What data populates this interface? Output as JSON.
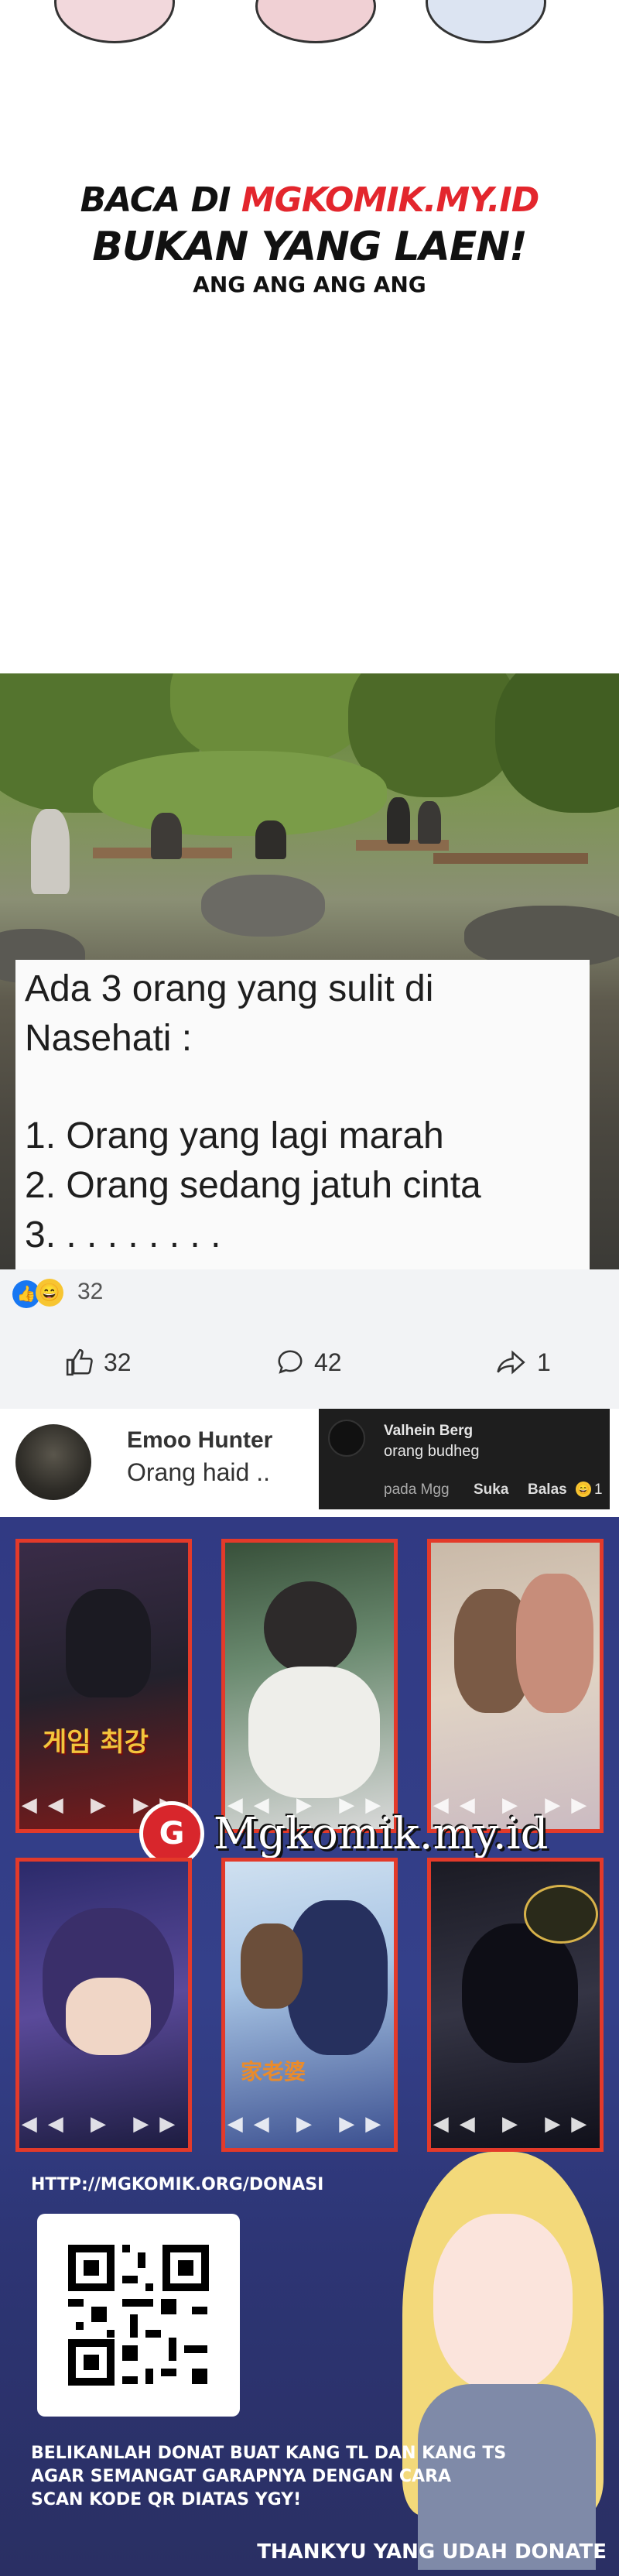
{
  "promo": {
    "line1_prefix": "BACA DI ",
    "line1_site": "MGKOMIK.MY.ID",
    "line2": "BUKAN YANG LAEN!",
    "line3": "ANG ANG ANG ANG"
  },
  "meme": {
    "text_line1": "Ada 3 orang yang sulit di",
    "text_line2": "Nasehati :",
    "item1": "1. Orang yang lagi marah",
    "item2": "2. Orang sedang jatuh cinta",
    "item3": "3. . . . . . . . .",
    "reaction_count": "32",
    "like_count": "32",
    "comment_count": "42",
    "share_count": "1"
  },
  "comment_main": {
    "author": "Emoo Hunter",
    "text": "Orang haid .."
  },
  "comment_reply": {
    "author": "Valhein Berg",
    "text": "orang budheg",
    "meta_left": "pada Mgg",
    "like_label": "Suka",
    "reply_label": "Balas",
    "reaction_count": "1"
  },
  "ad": {
    "brand_logo_letter": "G",
    "brand_name": "Mgkomik.my.id",
    "donate_url": "HTTP://MGKOMIK.ORG/DONASI",
    "donate_msg_line1": "BELIKANLAH DONAT BUAT KANG TL DAN KANG TS",
    "donate_msg_line2": "AGAR SEMANGAT GARAPNYA DENGAN CARA",
    "donate_msg_line3": "SCAN KODE QR DIATAS YGY!",
    "thanks": "THANKYU YANG UDAH DONATE",
    "cover_1_title": "게임 최강",
    "cover_5_title": "家老婆",
    "play_controls": "◀◀ ▶ ▶▶"
  },
  "colors": {
    "accent_red": "#e3262d",
    "ad_background": "#313a83",
    "fb_blue": "#1877f2"
  }
}
